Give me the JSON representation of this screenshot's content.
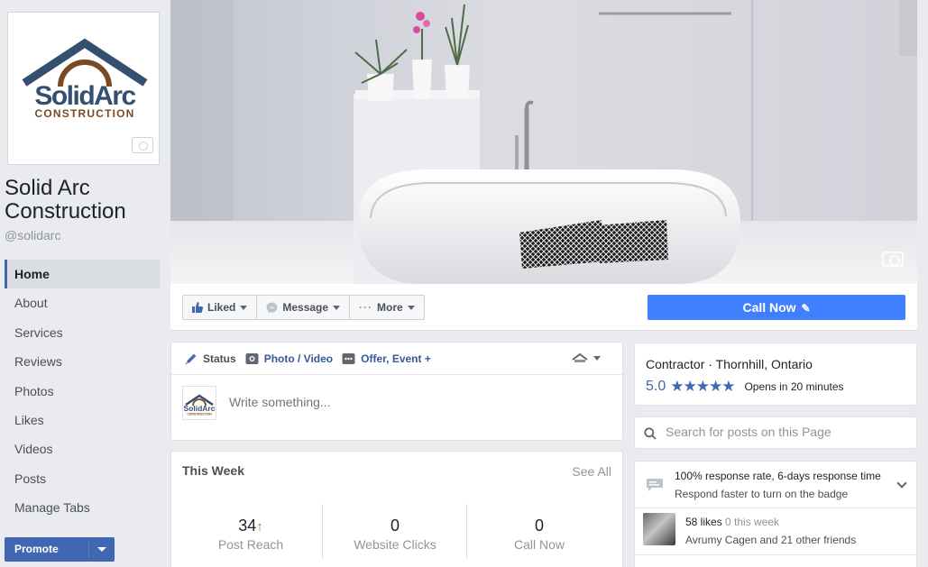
{
  "page": {
    "name": "Solid Arc Construction",
    "handle": "@solidarc",
    "logo_line1": "SolidArc",
    "logo_line2": "CONSTRUCTION"
  },
  "sidebar": {
    "items": [
      {
        "label": "Home",
        "active": true
      },
      {
        "label": "About"
      },
      {
        "label": "Services"
      },
      {
        "label": "Reviews"
      },
      {
        "label": "Photos"
      },
      {
        "label": "Likes"
      },
      {
        "label": "Videos"
      },
      {
        "label": "Posts"
      },
      {
        "label": "Manage Tabs"
      }
    ],
    "promote_label": "Promote"
  },
  "actions": {
    "liked": "Liked",
    "message": "Message",
    "more": "More",
    "call_now": "Call Now"
  },
  "composer": {
    "tab_status": "Status",
    "tab_photo": "Photo / Video",
    "tab_offer": "Offer, Event +",
    "placeholder": "Write something..."
  },
  "this_week": {
    "title": "This Week",
    "see_all": "See All",
    "stats": [
      {
        "value": "34",
        "label": "Post Reach",
        "trend": "up"
      },
      {
        "value": "0",
        "label": "Website Clicks"
      },
      {
        "value": "0",
        "label": "Call Now"
      }
    ]
  },
  "info": {
    "category": "Contractor · Thornhill, Ontario",
    "rating": "5.0",
    "stars": "★★★★★",
    "opens": "Opens in 20 minutes"
  },
  "search": {
    "placeholder": "Search for posts on this Page"
  },
  "response": {
    "title": "100% response rate, 6-days response time",
    "subtitle": "Respond faster to turn on the badge"
  },
  "likes": {
    "count": "58 likes",
    "week": "0 this week",
    "friends": "Avrumy Cagen and 21 other friends"
  },
  "colors": {
    "brand_blue": "#4267b2",
    "call_blue": "#4080ff",
    "logo_blue": "#34506e",
    "logo_brown": "#7a4a25"
  }
}
